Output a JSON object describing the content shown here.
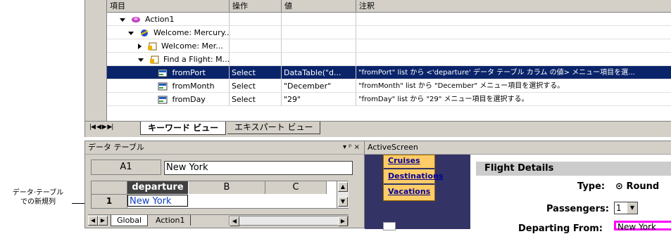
{
  "keyword_view": {
    "columns": [
      "項目",
      "操作",
      "値",
      "注釈"
    ],
    "rows": [
      {
        "item": "Action1",
        "op": "",
        "val": "",
        "note": ""
      },
      {
        "item": "Welcome: Mercury...",
        "op": "",
        "val": "",
        "note": ""
      },
      {
        "item": "Welcome: Mer...",
        "op": "",
        "val": "",
        "note": ""
      },
      {
        "item": "Find a Flight: M...",
        "op": "",
        "val": "",
        "note": ""
      },
      {
        "item": "fromPort",
        "op": "Select",
        "val": "DataTable(\"d...",
        "note": "\"fromPort\" list から <'departure' データ テーブル カラム の値> メニュー項目を選..."
      },
      {
        "item": "fromMonth",
        "op": "Select",
        "val": "\"December\"",
        "note": "\"fromMonth\" list から \"December\" メニュー項目を選択する。"
      },
      {
        "item": "fromDay",
        "op": "Select",
        "val": "\"29\"",
        "note": "\"fromDay\" list から \"29\" メニュー項目を選択する。"
      }
    ],
    "tabs": [
      "キーワード ビュー",
      "エキスパート ビュー"
    ],
    "nav_glyphs": "|◀ ◀ ▶ ▶|"
  },
  "data_table": {
    "title": "データ テーブル",
    "controls": "▾ ᵖ ×",
    "cell_ref": "A1",
    "cell_value": "New York",
    "col_headers": [
      "departure",
      "B",
      "C"
    ],
    "row_number": "1",
    "row_value": "New York",
    "sheet_tabs": [
      "Global",
      "Action1"
    ]
  },
  "annotation": {
    "line1": "データ·テーブル",
    "line2": "での新規列"
  },
  "active_screen": {
    "title": "ActiveScreen",
    "links": [
      "Cruises",
      "Destinations",
      "Vacations"
    ],
    "section_title": "Flight Details",
    "type_label": "Type:",
    "type_value": "Round",
    "passengers_label": "Passengers:",
    "passengers_value": "1",
    "departing_label": "Departing From:",
    "departing_value": "New York"
  }
}
